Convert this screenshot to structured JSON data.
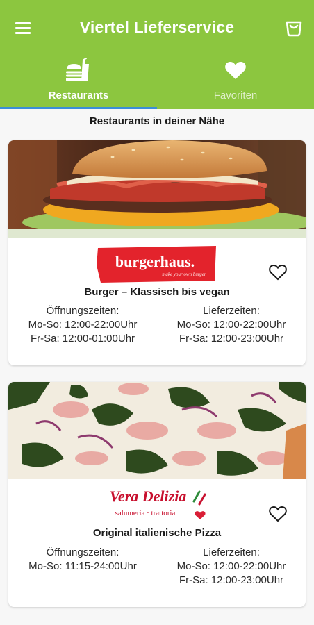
{
  "app": {
    "title": "Viertel Lieferservice"
  },
  "header": {
    "menu_icon": "menu-icon",
    "cart_icon": "shopping-bag-icon"
  },
  "tabs": [
    {
      "label": "Restaurants",
      "icon": "restaurant-icon",
      "active": true
    },
    {
      "label": "Favoriten",
      "icon": "heart-icon",
      "active": false
    }
  ],
  "section": {
    "title": "Restaurants in deiner Nähe"
  },
  "colors": {
    "primary": "#8cc63f",
    "tab_indicator": "#3b8ed8",
    "burgerhaus_red": "#e3232c",
    "vera_red": "#c8102e"
  },
  "restaurants": [
    {
      "brand": "burgerhaus.",
      "tagline": "make your own burger",
      "description": "Burger – Klassisch bis vegan",
      "opening_label": "Öffnungszeiten:",
      "opening_lines": [
        "Mo-So: 12:00-22:00Uhr",
        "Fr-Sa: 12:00-01:00Uhr"
      ],
      "delivery_label": "Lieferzeiten:",
      "delivery_lines": [
        "Mo-So: 12:00-22:00Uhr",
        "Fr-Sa: 12:00-23:00Uhr"
      ],
      "favorite": false
    },
    {
      "brand": "Vera Delizia",
      "tagline": "salumeria · trattoria",
      "description": "Original italienische Pizza",
      "opening_label": "Öffnungszeiten:",
      "opening_lines": [
        "Mo-So: 11:15-24:00Uhr"
      ],
      "delivery_label": "Lieferzeiten:",
      "delivery_lines": [
        "Mo-So: 12:00-22:00Uhr",
        "Fr-Sa: 12:00-23:00Uhr"
      ],
      "favorite": false
    }
  ]
}
